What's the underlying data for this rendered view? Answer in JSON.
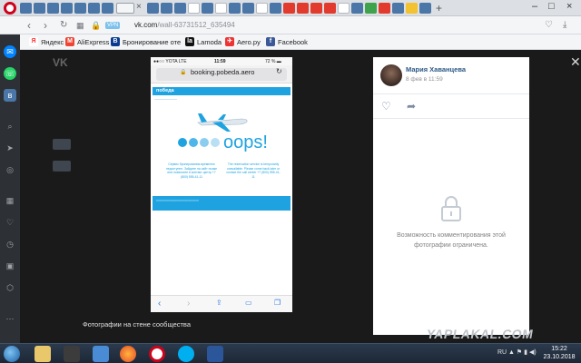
{
  "browser": {
    "url_host": "vk.com",
    "url_path": "/wall-63731512_635494",
    "vpn_label": "VPN",
    "window_controls": [
      "–",
      "□",
      "×"
    ]
  },
  "bookmarks": [
    {
      "label": "Яндекс",
      "icon": "Я",
      "color": "#f33"
    },
    {
      "label": "AliExpress",
      "icon": "M",
      "color": "#e43"
    },
    {
      "label": "Бронирование оте",
      "icon": "B",
      "color": "#0b3b8f"
    },
    {
      "label": "Lamoda",
      "icon": "la",
      "color": "#111"
    },
    {
      "label": "Aero.py",
      "icon": "✈",
      "color": "#e33"
    },
    {
      "label": "Facebook",
      "icon": "f",
      "color": "#3b5998"
    }
  ],
  "photo": {
    "status_carrier": "●●○○ YOTA  LTE",
    "status_time": "11:59",
    "status_battery": "72 % ▬",
    "host": "booking.pobeda.aero",
    "brand": "победа",
    "oops_text": "oops!",
    "error_ru": "Сервис бронирования временно недоступен. Зайдите на сайт позже или позвоните в контакт-центр +7 (800) 555-41-11",
    "error_en": "The reservation service is temporarily unavailable. Please come back later or contact the call center +7 (800) 555-41-11",
    "dot_colors": [
      "#1fa3e0",
      "#4fb6ea",
      "#8ccdef",
      "#b9dff5"
    ]
  },
  "caption": "Фотографии на стене сообщества",
  "post": {
    "author": "Мария Хаванцева",
    "date": "8 фев в 11:59",
    "restricted_text": "Возможность комментирования этой фотографии ограничена."
  },
  "watermark": "YAPLAKAL.COM",
  "taskbar": {
    "time": "15:22",
    "date": "23.10.2018",
    "tray": "RU ▲ ⚑ ▮ ◀)"
  }
}
